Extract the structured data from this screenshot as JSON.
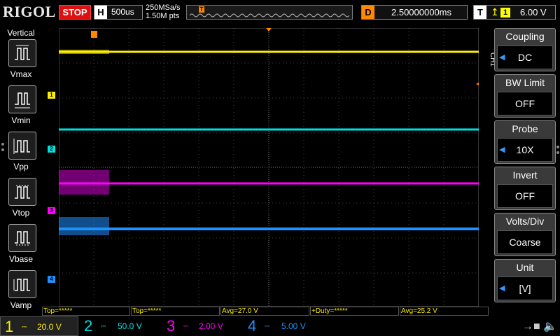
{
  "topbar": {
    "brand": "RIGOL",
    "run_state": "STOP",
    "timebase_label": "H",
    "timebase_value": "500us",
    "sample_rate": "250MSa/s",
    "memory_depth": "1.50M pts",
    "delay_label": "D",
    "delay_value": "2.50000000ms",
    "trigger_label": "T",
    "trigger_source": "1",
    "trigger_level": "6.00 V"
  },
  "sidebar": {
    "title": "Vertical",
    "items": [
      {
        "label": "Vmax",
        "icon": "vmax-icon"
      },
      {
        "label": "Vmin",
        "icon": "vmin-icon"
      },
      {
        "label": "Vpp",
        "icon": "vpp-icon"
      },
      {
        "label": "Vtop",
        "icon": "vtop-icon"
      },
      {
        "label": "Vbase",
        "icon": "vbase-icon"
      },
      {
        "label": "Vamp",
        "icon": "vamp-icon"
      }
    ]
  },
  "channels": [
    {
      "num": "1",
      "coupling_icon": "dc-coupling-icon",
      "scale": "20.0 V",
      "color": "#ffee00"
    },
    {
      "num": "2",
      "coupling_icon": "dc-coupling-icon",
      "scale": "50.0 V",
      "color": "#00e0e0"
    },
    {
      "num": "3",
      "coupling_icon": "dc-coupling-icon",
      "scale": "2.00 V",
      "color": "#ff00ff"
    },
    {
      "num": "4",
      "coupling_icon": "dc-coupling-icon",
      "scale": "5.00 V",
      "color": "#1e90ff"
    }
  ],
  "measurements": [
    {
      "text": "Top=*****",
      "color": "#ffee00"
    },
    {
      "text": "Top=*****",
      "color": "#ffee00"
    },
    {
      "text": "Avg=27.0 V",
      "color": "#ffee00"
    },
    {
      "text": "+Duty=*****",
      "color": "#ffee00"
    },
    {
      "text": "Avg=25.2 V",
      "color": "#ffee00"
    }
  ],
  "menu": {
    "channel_tab": "CH1",
    "items": [
      {
        "title": "Coupling",
        "value": "DC",
        "has_arrow": true
      },
      {
        "title": "BW Limit",
        "value": "OFF",
        "has_arrow": false
      },
      {
        "title": "Probe",
        "value": "10X",
        "has_arrow": true
      },
      {
        "title": "Invert",
        "value": "OFF",
        "has_arrow": false
      },
      {
        "title": "Volts/Div",
        "value": "Coarse",
        "has_arrow": false
      },
      {
        "title": "Unit",
        "value": "[V]",
        "has_arrow": true
      }
    ]
  },
  "colors": {
    "ch1": "#ffee00",
    "ch2": "#00e0e0",
    "ch3": "#ff00ff",
    "ch4": "#1e90ff",
    "trigger": "#ff8800",
    "stop": "#dd1111"
  }
}
